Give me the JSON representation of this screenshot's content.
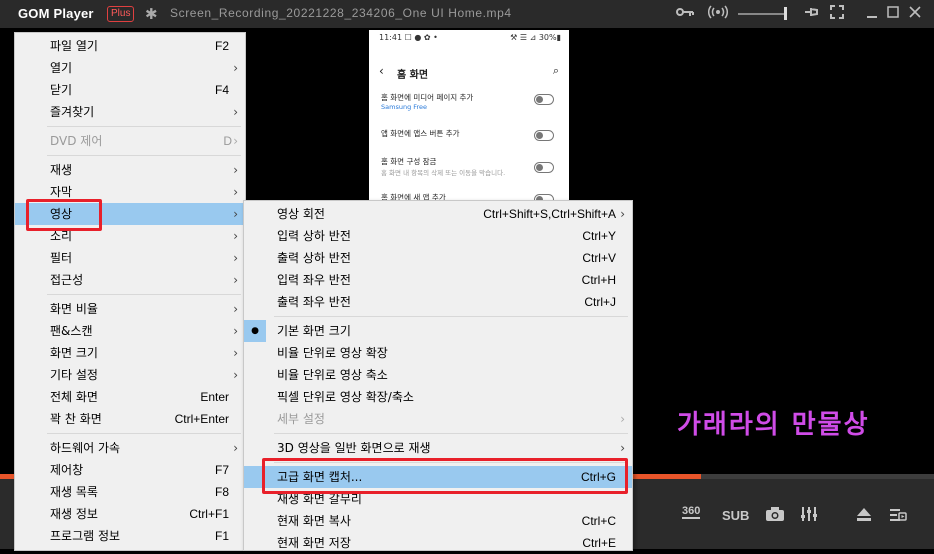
{
  "titlebar": {
    "app_name": "GOM Player",
    "plus_badge": "Plus",
    "file_name": "Screen_Recording_20221228_234206_One UI Home.mp4",
    "icons": [
      "settings-icon",
      "key-icon",
      "broadcast-icon",
      "volume-slider",
      "pin-icon",
      "fullscreen-icon",
      "minimize-icon",
      "maximize-icon",
      "close-icon"
    ]
  },
  "phone": {
    "status_left": "11:41 ☐ ● ✿ •",
    "status_right": "⚒ ☰ ⊿ 30%▮",
    "back": "‹",
    "header": "홈 화면",
    "search": "⌕",
    "rows": [
      {
        "label": "홈 화면에 미디어 페이지 추가",
        "sub": "Samsung Free"
      },
      {
        "label": "앱 화면에 앱스 버튼 추가",
        "sub": ""
      },
      {
        "label": "홈 화면 구성 잠금",
        "sub": "홈 화면 내 항목의 삭제 또는 이동을 막습니다."
      },
      {
        "label": "홈 화면에 새 앱 추가",
        "sub": ""
      }
    ]
  },
  "watermark": "가래라의 만물상",
  "progress": 0.75,
  "controls": {
    "btn_360": "360",
    "btn_sub": "SUB",
    "icons": [
      "camera-icon",
      "equalizer-icon",
      "eject-icon",
      "playlist-icon"
    ]
  },
  "main_menu": {
    "items": [
      {
        "label": "파일 열기",
        "shortcut": "F2",
        "arrow": ""
      },
      {
        "label": "열기",
        "shortcut": "",
        "arrow": "›"
      },
      {
        "label": "닫기",
        "shortcut": "F4",
        "arrow": ""
      },
      {
        "label": "즐겨찾기",
        "shortcut": "",
        "arrow": "›"
      },
      {
        "label": "DVD 제어",
        "shortcut": "D",
        "arrow": "›"
      },
      {
        "label": "재생",
        "shortcut": "",
        "arrow": "›"
      },
      {
        "label": "자막",
        "shortcut": "",
        "arrow": "›"
      },
      {
        "label": "영상",
        "shortcut": "",
        "arrow": "›"
      },
      {
        "label": "소리",
        "shortcut": "",
        "arrow": "›"
      },
      {
        "label": "필터",
        "shortcut": "",
        "arrow": "›"
      },
      {
        "label": "접근성",
        "shortcut": "",
        "arrow": "›"
      },
      {
        "label": "화면 비율",
        "shortcut": "",
        "arrow": "›"
      },
      {
        "label": "팬&스캔",
        "shortcut": "",
        "arrow": "›"
      },
      {
        "label": "화면 크기",
        "shortcut": "",
        "arrow": "›"
      },
      {
        "label": "기타 설정",
        "shortcut": "",
        "arrow": "›"
      },
      {
        "label": "전체 화면",
        "shortcut": "Enter",
        "arrow": ""
      },
      {
        "label": "꽉 찬 화면",
        "shortcut": "Ctrl+Enter",
        "arrow": ""
      },
      {
        "label": "하드웨어 가속",
        "shortcut": "",
        "arrow": "›"
      },
      {
        "label": "제어창",
        "shortcut": "F7",
        "arrow": ""
      },
      {
        "label": "재생 목록",
        "shortcut": "F8",
        "arrow": ""
      },
      {
        "label": "재생 정보",
        "shortcut": "Ctrl+F1",
        "arrow": ""
      },
      {
        "label": "프로그램 정보",
        "shortcut": "F1",
        "arrow": ""
      }
    ]
  },
  "sub_menu": {
    "items": [
      {
        "label": "영상 회전",
        "shortcut": "Ctrl+Shift+S,Ctrl+Shift+A",
        "arrow": "›"
      },
      {
        "label": "입력 상하 반전",
        "shortcut": "Ctrl+Y",
        "arrow": ""
      },
      {
        "label": "출력 상하 반전",
        "shortcut": "Ctrl+V",
        "arrow": ""
      },
      {
        "label": "입력 좌우 반전",
        "shortcut": "Ctrl+H",
        "arrow": ""
      },
      {
        "label": "출력 좌우 반전",
        "shortcut": "Ctrl+J",
        "arrow": ""
      },
      {
        "label": "기본 화면 크기",
        "shortcut": "",
        "arrow": "",
        "bullet": "●"
      },
      {
        "label": "비율 단위로 영상 확장",
        "shortcut": "",
        "arrow": ""
      },
      {
        "label": "비율 단위로 영상 축소",
        "shortcut": "",
        "arrow": ""
      },
      {
        "label": "픽셀 단위로 영상 확장/축소",
        "shortcut": "",
        "arrow": ""
      },
      {
        "label": "세부 설정",
        "shortcut": "",
        "arrow": "›"
      },
      {
        "label": "3D 영상을 일반 화면으로 재생",
        "shortcut": "",
        "arrow": "›"
      },
      {
        "label": "고급 화면 캡처...",
        "shortcut": "Ctrl+G",
        "arrow": ""
      },
      {
        "label": "재생 화면 갈무리",
        "shortcut": "",
        "arrow": ""
      },
      {
        "label": "현재 화면 복사",
        "shortcut": "Ctrl+C",
        "arrow": ""
      },
      {
        "label": "현재 화면 저장",
        "shortcut": "Ctrl+E",
        "arrow": ""
      }
    ]
  }
}
